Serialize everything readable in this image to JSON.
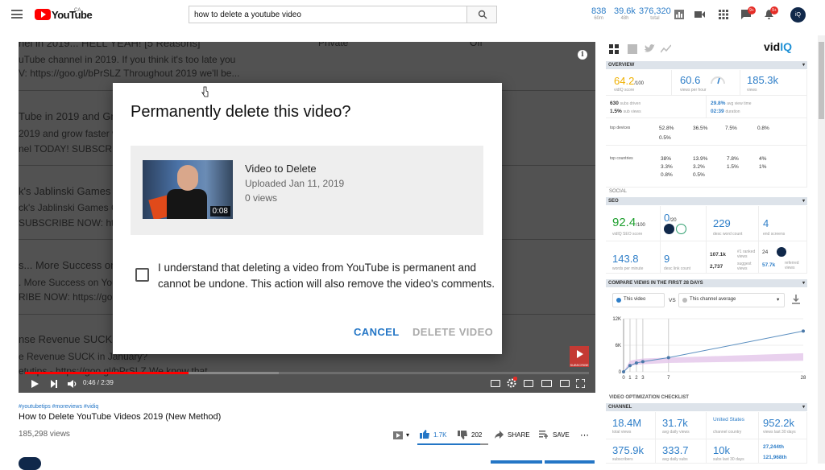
{
  "topbar": {
    "logo_text": "YouTube",
    "logo_region": "CA",
    "search_value": "how to delete a youtube video",
    "stats": [
      {
        "value": "838",
        "label": "60m"
      },
      {
        "value": "39.6k",
        "label": "48h"
      },
      {
        "value": "376,320",
        "label": "total"
      }
    ],
    "badge_apps": "9+",
    "badge_bell": "9+",
    "avatar_text": "iQ"
  },
  "player": {
    "ghost_lines": [
      "nel in 2019... HELL YEAH! [5 Reasons]",
      "Private",
      "Off",
      "uTube channel in 2019. If you think it's too late you",
      "V: https://goo.gl/bPrSLZ Throughout 2019 we'll be...",
      "Tube in 2019 and Grow",
      "2019 and grow faster w",
      "nel TODAY! SUBSCRIBE",
      "k's Jablinski Games Ch",
      "ck's Jablinski Games C",
      "SUBSCRIBE NOW: http",
      "s... More Success on Y",
      ". More Success on You",
      "RIBE NOW: https://goo",
      "nse Revenue SUCK in 2",
      "e Revenue SUCK in January?",
      "etutips - https://goo.gl/bPrSLZ We know that..."
    ],
    "endcard_label": "SUBSCRIBE",
    "time": "0:46 / 2:39",
    "progress": 0.29,
    "buffered": 0.45
  },
  "modal": {
    "title": "Permanently delete this video?",
    "video_title": "Video to Delete",
    "uploaded": "Uploaded Jan 11, 2019",
    "views": "0 views",
    "duration": "0:08",
    "ack_text": "I understand that deleting a video from YouTube is permanent and cannot be undone. This action will also remove the video's comments.",
    "cancel": "CANCEL",
    "delete": "DELETE VIDEO"
  },
  "video": {
    "hashtags": "#youtubetips #moreviews #vidiq",
    "title": "How to Delete YouTube Videos 2019 (New Method)",
    "views": "185,298 views",
    "likes": "1.7K",
    "dislikes": "202",
    "share": "SHARE",
    "save": "SAVE",
    "like_ratio": 0.89
  },
  "vidiq": {
    "logo": "vid",
    "logo_accent": "IQ",
    "overview": "OVERVIEW",
    "score": {
      "value": "64.2",
      "of": "/100",
      "label": "vidIQ score"
    },
    "vph": {
      "value": "60.6",
      "label": "views per hour"
    },
    "realtime": {
      "value": "185.3k",
      "label": "views"
    },
    "subs_driven": {
      "value": "630",
      "label": "subs driven"
    },
    "sub_views": {
      "value": "1.5%",
      "label": "sub views"
    },
    "avg_view_time": {
      "value": "29.8%",
      "label": "avg view time"
    },
    "duration": {
      "value": "02:39",
      "label": "duration"
    },
    "top_devices_label": "top devices",
    "devices": [
      "52.8%",
      "36.5%",
      "7.5%",
      "0.8%",
      "0.5%"
    ],
    "top_countries_label": "top countries",
    "countries": [
      "38%",
      "13.9%",
      "7.8%",
      "4%",
      "3.3%",
      "3.2%",
      "1.5%",
      "1%",
      "0.8%",
      "0.5%"
    ],
    "social": "SOCIAL",
    "seo": "SEO",
    "seo_score": {
      "value": "92.4",
      "of": "/100",
      "label": "vidIQ SEO score"
    },
    "seo_tags": {
      "value": "0",
      "of": "/20"
    },
    "desc_words": {
      "value": "229",
      "label": "desc word count"
    },
    "end_screens": {
      "value": "4",
      "label": "end screens"
    },
    "words_per_minute": {
      "value": "143.8",
      "label": "words per minute"
    },
    "desc_links": {
      "value": "9",
      "label": "desc link count"
    },
    "tag_views": {
      "value": "107.1k",
      "label": "#1 ranked views"
    },
    "tag_count": {
      "value": "2,737",
      "label": "suggest views"
    },
    "ref_count": {
      "value": "24"
    },
    "ref_views": {
      "value": "57.7k",
      "label": "referred views"
    },
    "compare": "COMPARE VIEWS IN THE FIRST 28 DAYS",
    "compare_this": "This video",
    "compare_vs": "VS",
    "compare_other": "This channel average",
    "checklist": "VIDEO OPTIMIZATION CHECKLIST",
    "channel": "CHANNEL",
    "ch_total": {
      "value": "18.4M",
      "label": "total views"
    },
    "ch_daily": {
      "value": "31.7k",
      "label": "avg daily views"
    },
    "ch_country": {
      "value": "United States",
      "label": "channel country"
    },
    "ch_30d": {
      "value": "952.2k",
      "label": "views last 30 days"
    },
    "ch_subs": {
      "value": "375.9k",
      "label": "subscribers"
    },
    "ch_daily_subs": {
      "value": "333.7",
      "label": "avg daily subs"
    },
    "ch_subs_30": {
      "value": "10k",
      "label": "subs last 30 days"
    },
    "ch_extra1": "27,244th",
    "ch_extra2": "121,968th"
  },
  "chart_data": {
    "type": "line",
    "x": [
      0,
      1,
      2,
      3,
      7,
      28
    ],
    "y_ticks": [
      "12K",
      "6K",
      "0"
    ],
    "x_ticks": [
      "0",
      "1",
      "2",
      "3",
      "7",
      "28"
    ],
    "ylim": [
      0,
      12000
    ],
    "series": [
      {
        "name": "This video",
        "values": [
          0,
          1400,
          2000,
          2300,
          3200,
          9200
        ]
      }
    ],
    "band": {
      "low": [
        0,
        1300,
        1600,
        1700,
        2000,
        2500
      ],
      "high": [
        0,
        2500,
        2800,
        3000,
        3200,
        4200
      ]
    }
  }
}
